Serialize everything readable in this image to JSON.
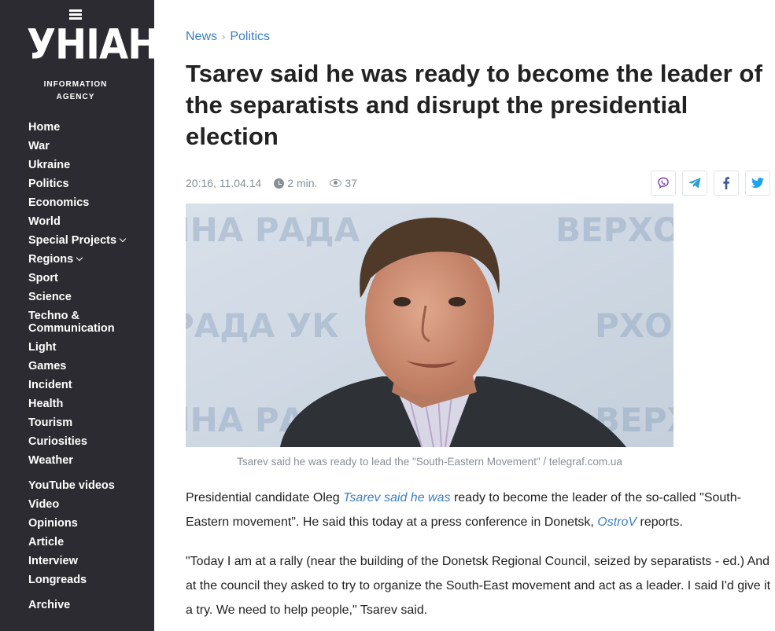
{
  "brand": {
    "logo_text": "УНІАН",
    "subtitle_line1": "INFORMATION",
    "subtitle_line2": "AGENCY"
  },
  "nav": {
    "items": [
      {
        "label": "Home"
      },
      {
        "label": "War"
      },
      {
        "label": "Ukraine"
      },
      {
        "label": "Politics"
      },
      {
        "label": "Economics"
      },
      {
        "label": "World"
      },
      {
        "label": "Special Projects"
      },
      {
        "label": "Regions"
      },
      {
        "label": "Sport"
      },
      {
        "label": "Science"
      },
      {
        "label": "Techno &"
      },
      {
        "label": "Communication"
      },
      {
        "label": "Light"
      },
      {
        "label": "Games"
      },
      {
        "label": "Incident"
      },
      {
        "label": "Health"
      },
      {
        "label": "Tourism"
      },
      {
        "label": "Curiosities"
      },
      {
        "label": "Weather"
      },
      {
        "label": "YouTube videos"
      },
      {
        "label": "Video"
      },
      {
        "label": "Opinions"
      },
      {
        "label": "Article"
      },
      {
        "label": "Interview"
      },
      {
        "label": "Longreads"
      },
      {
        "label": "Archive"
      }
    ]
  },
  "breadcrumb": {
    "items": [
      {
        "label": "News"
      },
      {
        "label": "Politics"
      }
    ],
    "separator": "›"
  },
  "article": {
    "title": "Tsarev said he was ready to become the leader of the separatists and disrupt the presidential election",
    "datetime": "20:16, 11.04.14",
    "read_time": "2 min.",
    "views": "37",
    "share_icons": [
      "viber-icon",
      "telegram-icon",
      "facebook-icon",
      "twitter-icon"
    ],
    "image_caption": "Tsarev said he was ready to lead the \"South-Eastern Movement\" / telegraf.com.ua",
    "p1": {
      "part1": "Presidential candidate Oleg ",
      "link1": "Tsarev said he was",
      "part2": " ready to become the leader of the so-called \"South-Eastern movement\". He said this today at a press conference in Donetsk, ",
      "link2": "OstroV",
      "part3": " reports."
    },
    "p2": "\"Today I am at a rally (near the building of the Donetsk Regional Council, seized by separatists - ed.) And at the council they asked to try to organize the South-East movement and act as a leader. I said I'd give it a try. We need to help people,\" Tsarev said."
  },
  "colors": {
    "sidebar_bg": "#2b2b31",
    "link": "#3c7ec1",
    "meta": "#8a8f96",
    "viber": "#7d3daf",
    "telegram": "#2a9fd6",
    "facebook": "#3b5998",
    "twitter": "#1da1f2"
  }
}
